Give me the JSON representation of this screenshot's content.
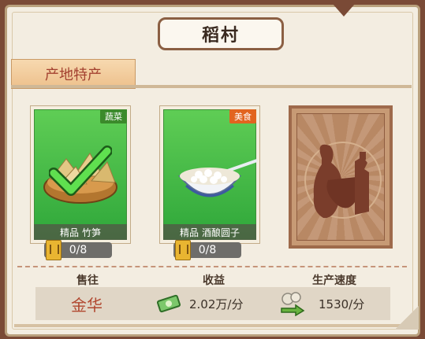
{
  "title": "稻村",
  "section_title": "产地特产",
  "cards": [
    {
      "quality": "精品",
      "name": "竹笋",
      "tag": "蔬菜",
      "count": "0/8"
    },
    {
      "quality": "精品",
      "name": "酒酿圆子",
      "tag": "美食",
      "count": "0/8"
    }
  ],
  "stats": {
    "destination_label": "售往",
    "destination_value": "金华",
    "income_label": "收益",
    "income_value": "2.02万/分",
    "speed_label": "生产速度",
    "speed_value": "1530/分"
  },
  "colors": {
    "panel_bg": "#f3ede1",
    "outer_bg": "#7a4a36",
    "tag_green": "#3b8a2b",
    "tag_orange": "#e2641f",
    "card_green": "#3bb14a",
    "accent_red": "#b1472f"
  },
  "icons": [
    "check-icon",
    "coupon-icon",
    "money-icon",
    "speed-icon",
    "jar-silhouette-icon"
  ]
}
